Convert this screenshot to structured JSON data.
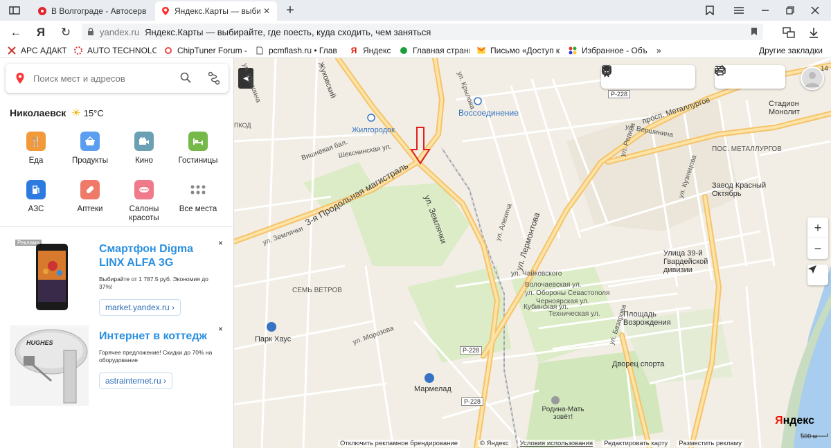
{
  "browser": {
    "tabs": [
      {
        "title": "В Волгограде - Автосерви",
        "active": false
      },
      {
        "title": "Яндекс.Карты — выбирай",
        "active": true
      }
    ],
    "new_tab_label": "+",
    "address": {
      "domain": "yandex.ru",
      "title": "Яндекс.Карты — выбирайте, где поесть, куда сходить, чем заняться"
    },
    "bookmarks": [
      {
        "label": "APC АДАКТ",
        "icon": "bookmark-icon"
      },
      {
        "label": "AUTO TECHNOLOG",
        "icon": "bookmark-icon"
      },
      {
        "label": "ChipTuner Forum -",
        "icon": "bookmark-icon"
      },
      {
        "label": "pcmflash.ru • Глав",
        "icon": "page-icon"
      },
      {
        "label": "Яндекс",
        "icon": "yandex-icon"
      },
      {
        "label": "Главная страница",
        "icon": "bookmark-icon"
      },
      {
        "label": "Письмо «Доступ к",
        "icon": "mail-icon"
      },
      {
        "label": "Избранное - Объ",
        "icon": "bookmark-icon"
      }
    ],
    "more_bookmarks": "»",
    "other_bookmarks": "Другие закладки"
  },
  "panel": {
    "search": {
      "placeholder": "Поиск мест и адресов"
    },
    "weather": {
      "city": "Николаевск",
      "temp": "15°C"
    },
    "categories": [
      {
        "label": "Еда",
        "color": "#f29a3a"
      },
      {
        "label": "Продукты",
        "color": "#5b9ef0"
      },
      {
        "label": "Кино",
        "color": "#6a9fb4"
      },
      {
        "label": "Гостиницы",
        "color": "#74b94a"
      },
      {
        "label": "АЗС",
        "color": "#2d7be0"
      },
      {
        "label": "Аптеки",
        "color": "#f07a6a"
      },
      {
        "label": "Салоны красоты",
        "color": "#f07a8a"
      },
      {
        "label": "Все места",
        "color": "#888888"
      }
    ],
    "ads": [
      {
        "label": "Реклама",
        "title": "Смартфон Digma LINX ALFA 3G",
        "desc": "Выбирайте от 1 787.5 руб. Экономия до 37%!",
        "button": "market.yandex.ru ›",
        "close": "×"
      },
      {
        "title": "Интернет в коттедж",
        "desc": "Горячее предложение! Скидки до 70% на оборудование",
        "button": "astrainternet.ru ›",
        "close": "×",
        "brand": "HUGHES"
      }
    ]
  },
  "map": {
    "labels": {
      "street_zemlyachki": "ул. Землячки",
      "street_zemlyachki2": "ул. Землячки",
      "prodolnaya": "3-я Продольная магистраль",
      "lermontova": "ул. Лермонтова",
      "metallurgov": "просп. Металлургов",
      "zhilgorodok": "Жилгородок",
      "vossoedinenie": "Воссоединение",
      "sem_vetrov": "СЕМЬ ВЕТРОВ",
      "park_haus": "Парк Хаус",
      "marmelad": "Мармелад",
      "rodina_mat": "Родина-Мать зовёт!",
      "stadion": "Стадион Монолит",
      "zavod": "Завод Красный Октябрь",
      "ulitsa39": "Улица 39-й Гвардейской дивизии",
      "ploshad": "Площадь Возрождения",
      "dvorets": "Дворец спорта",
      "pos_metallurgov": "ПОС. МЕТАЛЛУРГОВ",
      "vishnevaya": "Вишнёвая бал.",
      "morozova": "ул. Морозова",
      "kubinskaya": "Кубинская ул.",
      "repina": "ул. Репина",
      "shekhsinskaya": "Шекснинская ул.",
      "krylova": "ул. Крылова",
      "chaykovskogo": "ул. Чайковского",
      "volochaevskaya": "Волочаевская ул.",
      "oborony": "ул. Обороны Севастополя",
      "chernyarskaya": "Черноярская ул.",
      "tekhnicheskaya": "Техническая ул.",
      "bazarova": "ул. Базарова",
      "vershinina": "ул. Вершинина",
      "kuznetsova": "ул. Кузнецова",
      "alekhina": "ул. Алехина",
      "novosibirskaya": "ул. Шукшина",
      "prkd": "ПКОД",
      "zhdanov": "Жуковский"
    },
    "shields": [
      "P-228",
      "P-228",
      "P-228"
    ],
    "footer": {
      "disable_ads": "Отключить рекламное брендирование",
      "copyright": "© Яндекс",
      "terms": "Условия использования",
      "edit": "Редактировать карту",
      "place_ad": "Разместить рекламу"
    },
    "logo_first": "Я",
    "logo_rest": "ндекс",
    "scale": "500 м",
    "zoom_in": "+",
    "zoom_out": "−",
    "corner_number": "14"
  }
}
